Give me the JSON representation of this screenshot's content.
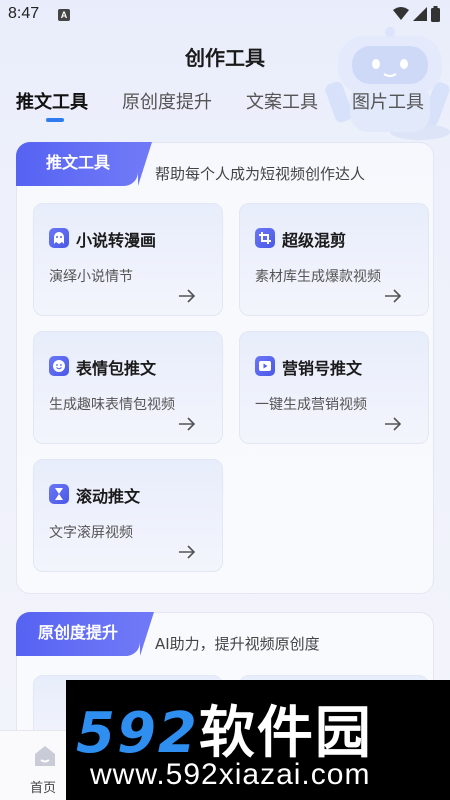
{
  "status": {
    "time": "8:47",
    "indicator": "A"
  },
  "header": {
    "title": "创作工具"
  },
  "tabs": [
    {
      "label": "推文工具",
      "active": true
    },
    {
      "label": "原创度提升",
      "active": false
    },
    {
      "label": "文案工具",
      "active": false
    },
    {
      "label": "图片工具",
      "active": false
    }
  ],
  "sections": [
    {
      "badge": "推文工具",
      "description": "帮助每个人成为短视频创作达人",
      "cards": [
        {
          "title": "小说转漫画",
          "subtitle": "演绎小说情节",
          "icon": "ghost-icon"
        },
        {
          "title": "超级混剪",
          "subtitle": "素材库生成爆款视频",
          "icon": "crop-icon"
        },
        {
          "title": "表情包推文",
          "subtitle": "生成趣味表情包视频",
          "icon": "smiley-icon"
        },
        {
          "title": "营销号推文",
          "subtitle": "一键生成营销视频",
          "icon": "play-icon"
        },
        {
          "title": "滚动推文",
          "subtitle": "文字滚屏视频",
          "icon": "hourglass-icon"
        }
      ]
    },
    {
      "badge": "原创度提升",
      "description": "AI助力，提升视频原创度"
    }
  ],
  "bottom_nav": {
    "home_label": "首页"
  },
  "watermark": {
    "logo_digits": "592",
    "logo_text": "软件园",
    "url": "www.592xiazai.com"
  },
  "colors": {
    "accent": "#5663f2",
    "tab_indicator": "#2f7bf0",
    "watermark_blue": "#2f8ff0"
  }
}
